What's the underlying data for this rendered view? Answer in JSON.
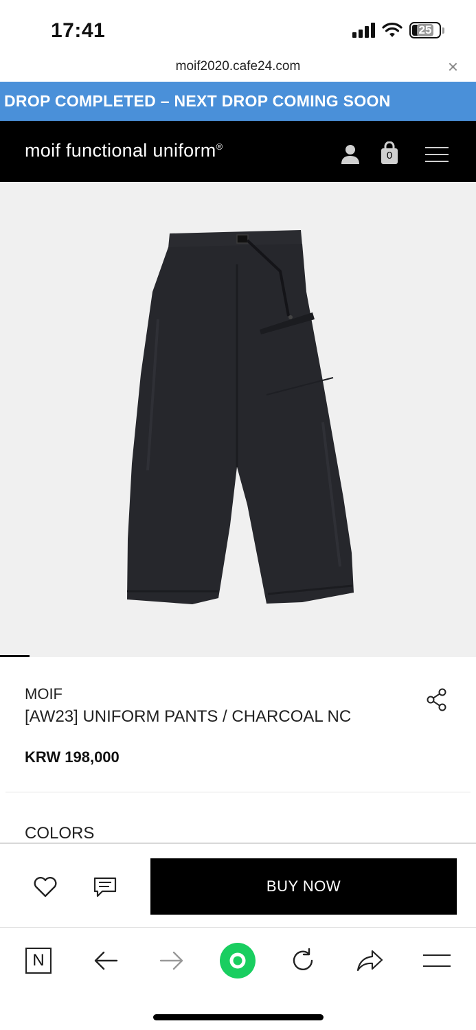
{
  "status_bar": {
    "time": "17:41",
    "battery": "25"
  },
  "browser": {
    "url": "moif2020.cafe24.com",
    "close": "×"
  },
  "announcement": "DROP COMPLETED – NEXT DROP COMING SOON",
  "header": {
    "brand": "moif functional uniform",
    "registered": "®",
    "cart_count": "0"
  },
  "product": {
    "brand": "MOIF",
    "title": "[AW23] UNIFORM PANTS / CHARCOAL NC",
    "price": "KRW 198,000",
    "colors_label": "COLORS"
  },
  "actions": {
    "buy_now": "BUY NOW"
  },
  "toolbar": {
    "naver_label": "N"
  },
  "colors": {
    "announcement_bg": "#4a90d9",
    "header_bg": "#000000",
    "image_bg": "#f0f0f0",
    "accent_green": "#19ce60"
  },
  "icons": [
    "user-icon",
    "shopping-bag-icon",
    "hamburger-menu-icon",
    "share-icon",
    "heart-icon",
    "review-icon",
    "back-arrow-icon",
    "forward-arrow-icon",
    "reload-icon",
    "share-arrow-icon",
    "menu-icon"
  ]
}
